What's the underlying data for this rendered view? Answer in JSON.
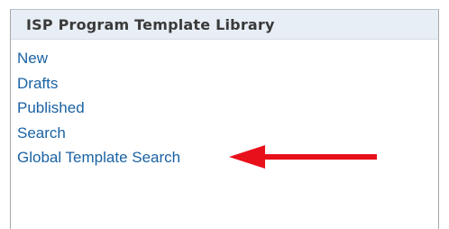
{
  "panel": {
    "title": "ISP Program Template Library"
  },
  "nav": {
    "items": [
      {
        "label": "New"
      },
      {
        "label": "Drafts"
      },
      {
        "label": "Published"
      },
      {
        "label": "Search"
      },
      {
        "label": "Global Template Search"
      }
    ]
  },
  "annotation": {
    "arrow_color": "#e8101a",
    "points_to": "Global Template Search"
  },
  "colors": {
    "header_bg": "#e8eef5",
    "link": "#1a62a4",
    "title": "#3a3a3a"
  }
}
